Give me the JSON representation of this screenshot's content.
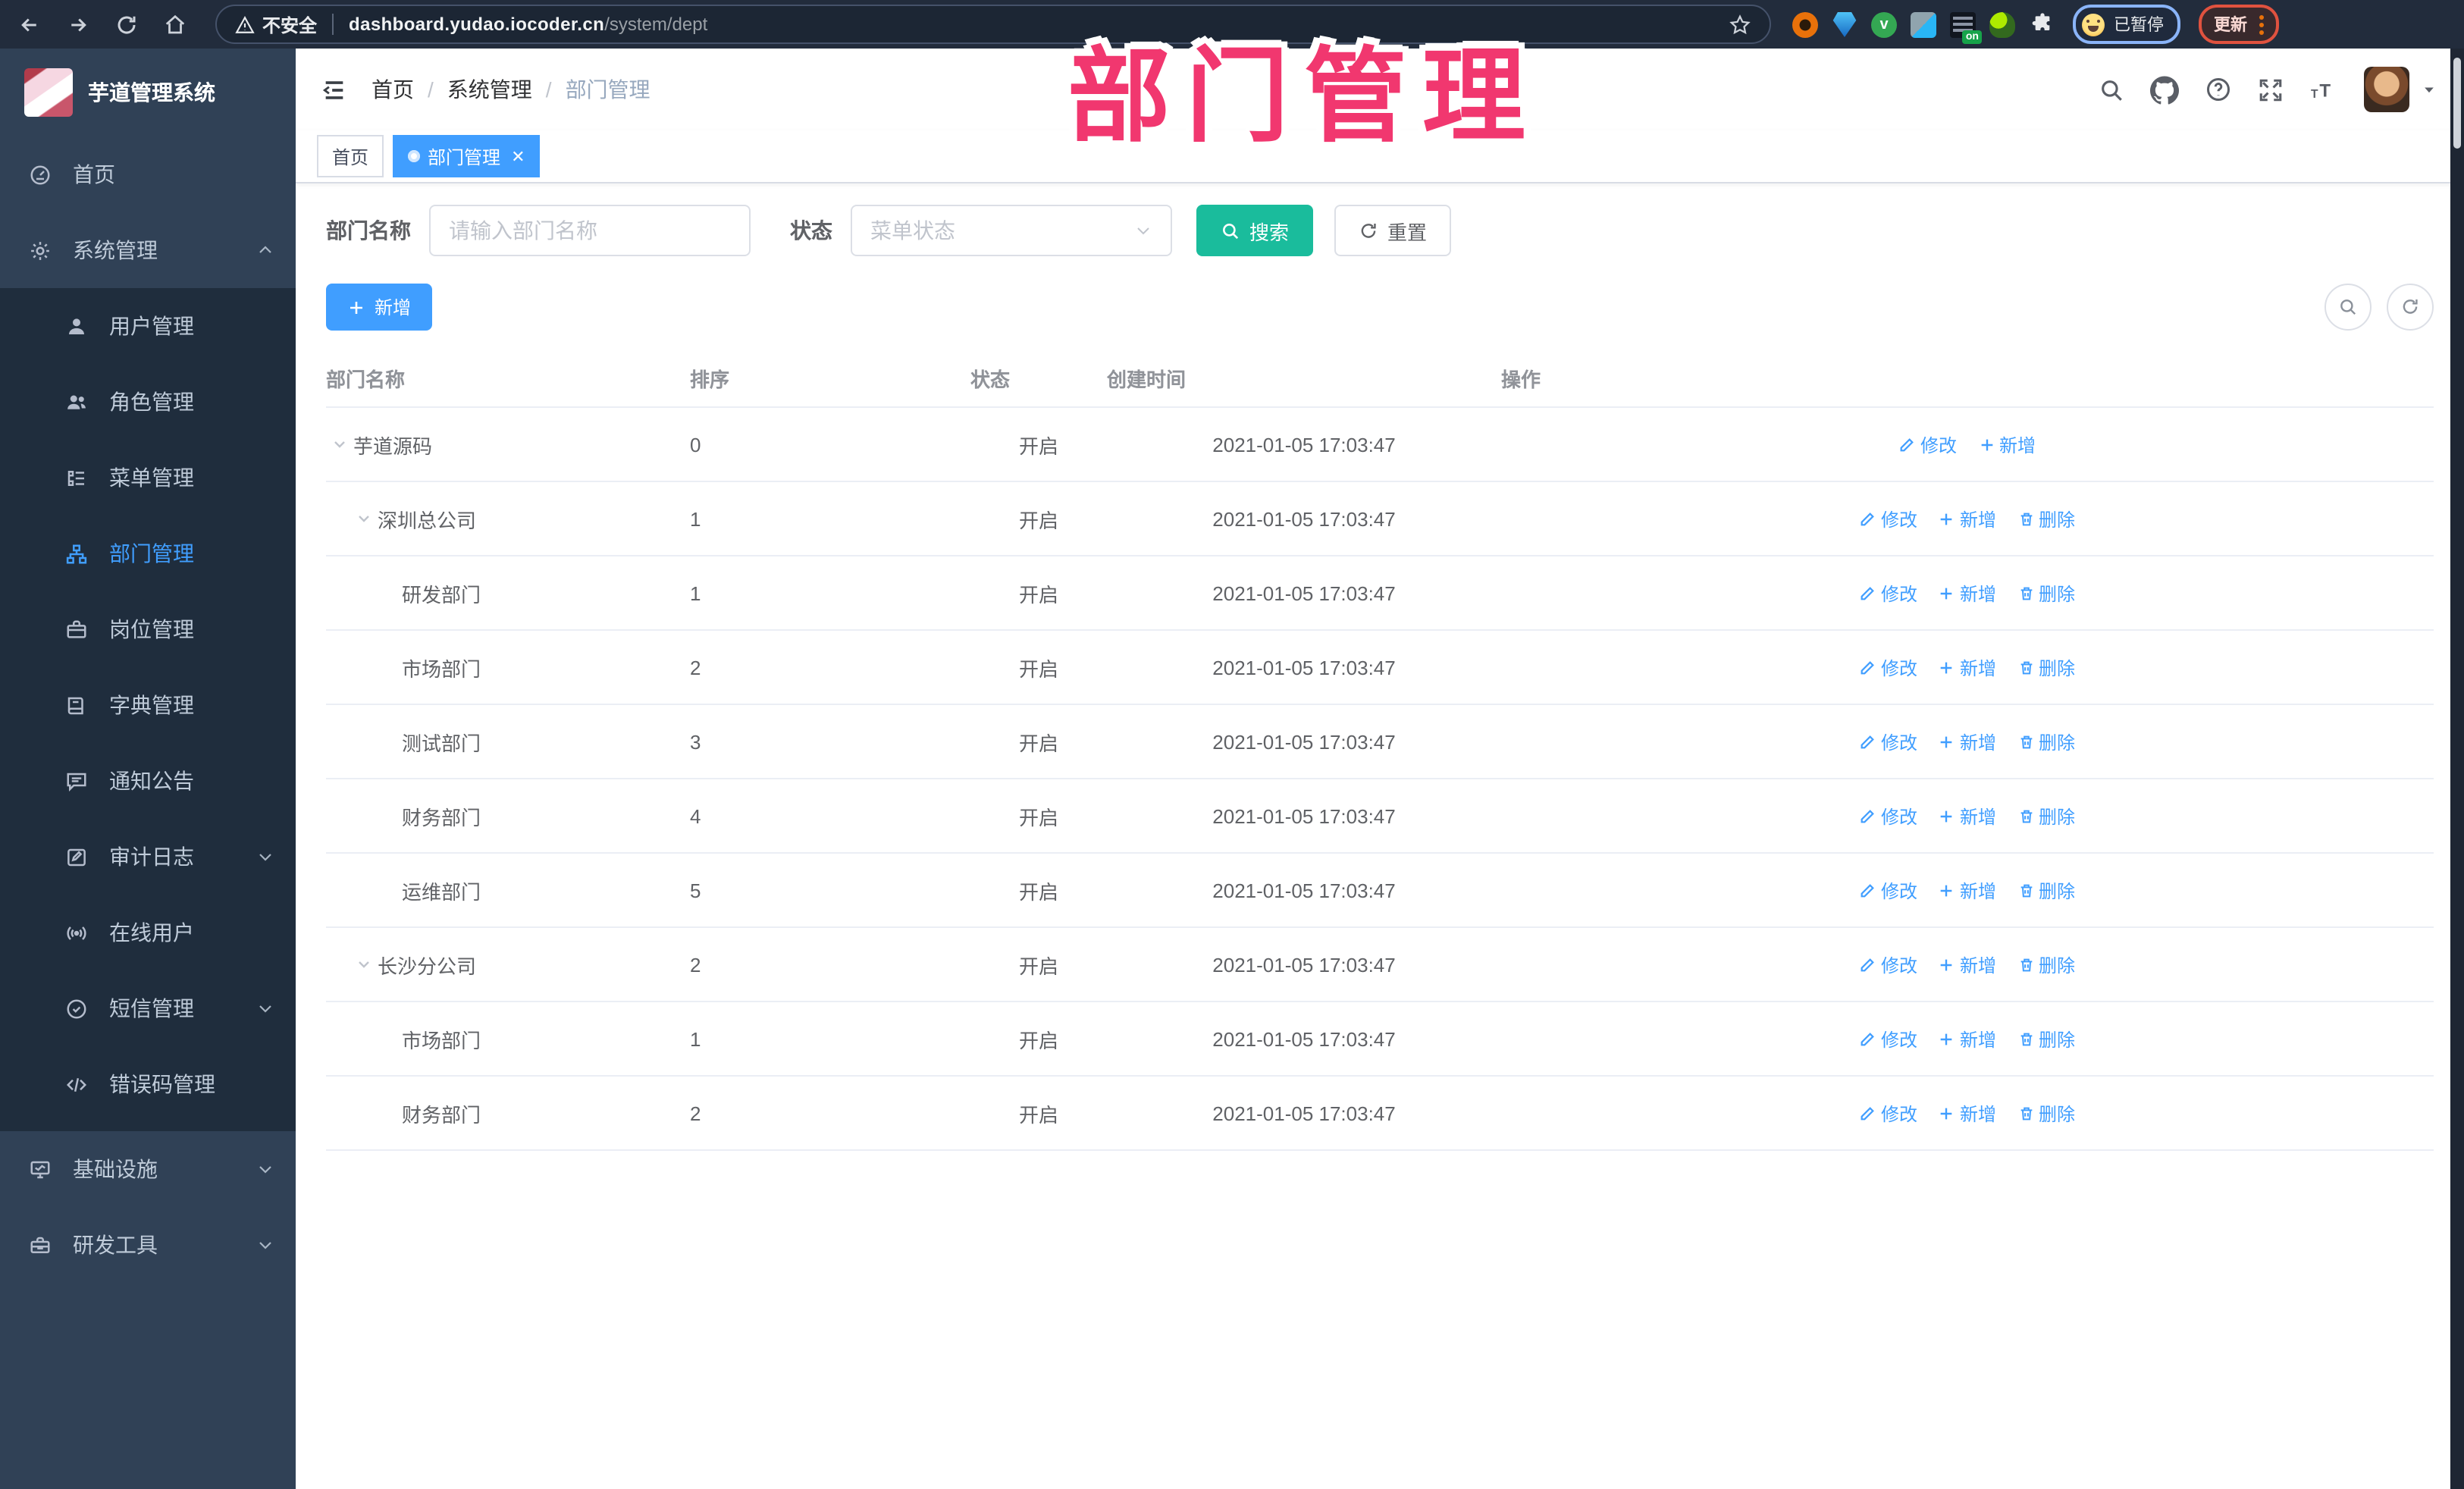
{
  "colors": {
    "accent": "#409EFF",
    "search_button": "#1ABC9C",
    "overlay_title": "#F1376F",
    "sidebar_bg": "#304156",
    "submenu_bg": "#1F2D3D"
  },
  "browser": {
    "security_label": "不安全",
    "url_host": "dashboard.yudao.iocoder.cn",
    "url_path": "/system/dept",
    "extensions": [
      "ext-circle-orange",
      "ext-pin-blue",
      "ext-badge-green",
      "ext-grid-blue",
      "ext-list-on",
      "ext-figure-green",
      "ext-puzzle"
    ],
    "ext_on_badge": "on",
    "paused_label": "已暂停",
    "update_label": "更新"
  },
  "overlay_title": "部门管理",
  "sidebar": {
    "app_title": "芋道管理系统",
    "items": [
      {
        "label": "首页",
        "icon": "dashboard",
        "kind": "root"
      },
      {
        "label": "系统管理",
        "icon": "gear",
        "kind": "root",
        "chevron": "up"
      },
      {
        "label": "用户管理",
        "icon": "user",
        "kind": "sub"
      },
      {
        "label": "角色管理",
        "icon": "users",
        "kind": "sub"
      },
      {
        "label": "菜单管理",
        "icon": "menulist",
        "kind": "sub"
      },
      {
        "label": "部门管理",
        "icon": "org",
        "kind": "sub",
        "active": true
      },
      {
        "label": "岗位管理",
        "icon": "briefcase",
        "kind": "sub"
      },
      {
        "label": "字典管理",
        "icon": "book",
        "kind": "sub"
      },
      {
        "label": "通知公告",
        "icon": "bubble",
        "kind": "sub"
      },
      {
        "label": "审计日志",
        "icon": "audit",
        "kind": "sub",
        "chevron": "down"
      },
      {
        "label": "在线用户",
        "icon": "online",
        "kind": "sub"
      },
      {
        "label": "短信管理",
        "icon": "sms",
        "kind": "sub",
        "chevron": "down"
      },
      {
        "label": "错误码管理",
        "icon": "code",
        "kind": "sub"
      },
      {
        "label": "基础设施",
        "icon": "monitor",
        "kind": "root",
        "chevron": "down"
      },
      {
        "label": "研发工具",
        "icon": "toolbox",
        "kind": "root",
        "chevron": "down"
      }
    ]
  },
  "header": {
    "breadcrumb": [
      "首页",
      "系统管理",
      "部门管理"
    ],
    "icons": [
      "search",
      "github",
      "question",
      "fullscreen",
      "fontsize"
    ]
  },
  "tabs": [
    {
      "label": "首页",
      "active": false
    },
    {
      "label": "部门管理",
      "active": true,
      "closable": true
    }
  ],
  "filters": {
    "dept_label": "部门名称",
    "dept_placeholder": "请输入部门名称",
    "status_label": "状态",
    "status_placeholder": "菜单状态",
    "search_label": "搜索",
    "reset_label": "重置"
  },
  "toolbar": {
    "add_label": "新增"
  },
  "table": {
    "columns": [
      "部门名称",
      "排序",
      "状态",
      "创建时间",
      "操作"
    ],
    "action_labels": {
      "modify": "修改",
      "add": "新增",
      "delete": "删除"
    },
    "rows": [
      {
        "name": "芋道源码",
        "level": 0,
        "caret": true,
        "order": "0",
        "status": "开启",
        "created": "2021-01-05 17:03:47",
        "actions": [
          "modify",
          "add"
        ]
      },
      {
        "name": "深圳总公司",
        "level": 1,
        "caret": true,
        "order": "1",
        "status": "开启",
        "created": "2021-01-05 17:03:47",
        "actions": [
          "modify",
          "add",
          "delete"
        ]
      },
      {
        "name": "研发部门",
        "level": 2,
        "caret": false,
        "order": "1",
        "status": "开启",
        "created": "2021-01-05 17:03:47",
        "actions": [
          "modify",
          "add",
          "delete"
        ]
      },
      {
        "name": "市场部门",
        "level": 2,
        "caret": false,
        "order": "2",
        "status": "开启",
        "created": "2021-01-05 17:03:47",
        "actions": [
          "modify",
          "add",
          "delete"
        ]
      },
      {
        "name": "测试部门",
        "level": 2,
        "caret": false,
        "order": "3",
        "status": "开启",
        "created": "2021-01-05 17:03:47",
        "actions": [
          "modify",
          "add",
          "delete"
        ]
      },
      {
        "name": "财务部门",
        "level": 2,
        "caret": false,
        "order": "4",
        "status": "开启",
        "created": "2021-01-05 17:03:47",
        "actions": [
          "modify",
          "add",
          "delete"
        ]
      },
      {
        "name": "运维部门",
        "level": 2,
        "caret": false,
        "order": "5",
        "status": "开启",
        "created": "2021-01-05 17:03:47",
        "actions": [
          "modify",
          "add",
          "delete"
        ]
      },
      {
        "name": "长沙分公司",
        "level": 1,
        "caret": true,
        "order": "2",
        "status": "开启",
        "created": "2021-01-05 17:03:47",
        "actions": [
          "modify",
          "add",
          "delete"
        ]
      },
      {
        "name": "市场部门",
        "level": 2,
        "caret": false,
        "order": "1",
        "status": "开启",
        "created": "2021-01-05 17:03:47",
        "actions": [
          "modify",
          "add",
          "delete"
        ]
      },
      {
        "name": "财务部门",
        "level": 2,
        "caret": false,
        "order": "2",
        "status": "开启",
        "created": "2021-01-05 17:03:47",
        "actions": [
          "modify",
          "add",
          "delete"
        ]
      }
    ]
  }
}
